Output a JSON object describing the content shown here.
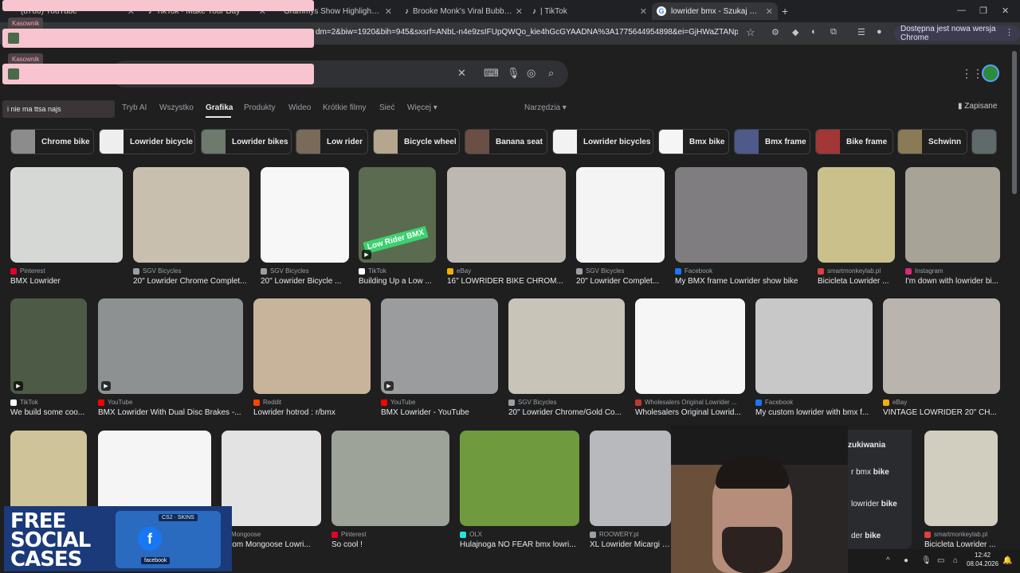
{
  "browser": {
    "tabs": [
      {
        "label": "(8786) YouTube"
      },
      {
        "label": "TikTok - Make Your Day"
      },
      {
        "label": "Grammys Show Highlights | Tik"
      },
      {
        "label": "Brooke Monk's Viral Bubble Tre"
      },
      {
        "label": "| TikTok"
      },
      {
        "label": "lowrider bmx - Szukaj w Google",
        "active": true
      }
    ],
    "url": "dm=2&biw=1920&bih=945&sxsrf=ANbL-n4e9zsIFUpQWQo_kie4hGcGYAADNA%3A1775644954898&ei=GjHWaZTANpS3wPAP...",
    "update_label": "Dostępna jest nowa wersja Chrome"
  },
  "overlay": {
    "chips": [
      "Kasownik",
      "Kasownik"
    ],
    "chat_line": "i nie ma ttsa najs"
  },
  "google": {
    "nav": [
      "Tryb AI",
      "Wszystko",
      "Grafika",
      "Produkty",
      "Wideo",
      "Krótkie filmy",
      "Sieć",
      "Więcej"
    ],
    "active_nav": "Grafika",
    "tools_label": "Narzędzia",
    "saved_label": "Zapisane"
  },
  "chips": [
    "Chrome bike",
    "Lowrider bicycle",
    "Lowrider bikes",
    "Low rider",
    "Bicycle wheel",
    "Banana seat",
    "Lowrider bicycles",
    "Bmx bike",
    "Bmx frame",
    "Bike frame",
    "Schwinn"
  ],
  "results": {
    "row1": [
      {
        "source": "Pinterest",
        "title": "BMX Lowrider",
        "fav": "#e60023"
      },
      {
        "source": "SGV Bicycles",
        "title": "20\" Lowrider Chrome Complet...",
        "fav": "#9aa0a6"
      },
      {
        "source": "SGV Bicycles",
        "title": "20\" Lowrider Bicycle ...",
        "fav": "#9aa0a6"
      },
      {
        "source": "TikTok",
        "title": "Building Up a Low ...",
        "fav": "#ffffff",
        "overlay": "Low Rider BMX"
      },
      {
        "source": "eBay",
        "title": "16\" LOWRIDER BIKE CHROM...",
        "fav": "#f5af02"
      },
      {
        "source": "SGV Bicycles",
        "title": "20\" Lowrider Complet...",
        "fav": "#9aa0a6"
      },
      {
        "source": "Facebook",
        "title": "My BMX frame Lowrider show bike",
        "fav": "#1877f2"
      },
      {
        "source": "smartmonkeylab.pl",
        "title": "Bicicleta Lowrider ...",
        "fav": "#e04040"
      },
      {
        "source": "Instagram",
        "title": "I'm down with lowrider bi...",
        "fav": "#d62976"
      }
    ],
    "row2": [
      {
        "source": "TikTok",
        "title": "We build some coo...",
        "fav": "#ffffff"
      },
      {
        "source": "YouTube",
        "title": "BMX Lowrider With Dual Disc Brakes -...",
        "fav": "#ff0000"
      },
      {
        "source": "Reddit",
        "title": "Lowrider hotrod : r/bmx",
        "fav": "#ff4500"
      },
      {
        "source": "YouTube",
        "title": "BMX Lowrider - YouTube",
        "fav": "#ff0000"
      },
      {
        "source": "SGV Bicycles",
        "title": "20\" Lowrider Chrome/Gold Co...",
        "fav": "#9aa0a6"
      },
      {
        "source": "Wholesalers Original Lowrider ...",
        "title": "Wholesalers Original Lowrid...",
        "fav": "#c0392b"
      },
      {
        "source": "Facebook",
        "title": "My custom lowrider with bmx f...",
        "fav": "#1877f2"
      },
      {
        "source": "eBay",
        "title": "VINTAGE LOWRIDER 20\" CH...",
        "fav": "#f5af02"
      }
    ],
    "row3": [
      {
        "source": "",
        "title": "",
        "fav": "#9aa0a6"
      },
      {
        "source": "",
        "title": "",
        "fav": "#9aa0a6"
      },
      {
        "source": "Mongoose",
        "title": "ustom Mongoose Lowri...",
        "fav": "#9aa0a6"
      },
      {
        "source": "Pinterest",
        "title": "So cool !",
        "fav": "#e60023"
      },
      {
        "source": "OLX",
        "title": "Hulajnoga NO FEAR bmx lowri...",
        "fav": "#23e5db"
      },
      {
        "source": "ROOWERY.pl",
        "title": "XL Lowrider Micargi H...",
        "fav": "#9aa0a6"
      },
      {
        "source": "smartmonkeylab.pl",
        "title": "Bicicleta Lowrider ...",
        "fav": "#e04040"
      }
    ]
  },
  "related_popover": {
    "heading": "zukiwania",
    "items": [
      {
        "prefix": "r bmx ",
        "bold": "bike"
      },
      {
        "prefix": "lowrider ",
        "bold": "bike"
      },
      {
        "prefix": "der ",
        "bold": "bike"
      }
    ]
  },
  "promo": {
    "line1": "FREE",
    "line2": "SOCIAL",
    "line3": "CASES",
    "tag": "CS2 · SKINS",
    "badge": "facebook"
  },
  "taskbar": {
    "time": "12:42",
    "date": "08.04.2026"
  }
}
